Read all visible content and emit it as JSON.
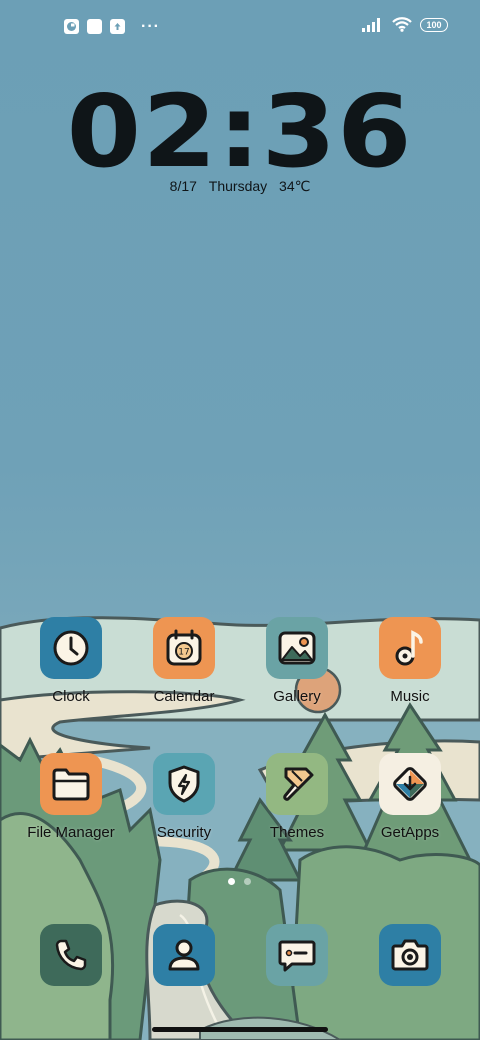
{
  "status_bar": {
    "left_icons": [
      "app-notification-icon",
      "square-notification-icon",
      "upload-notification-icon"
    ],
    "overflow": "···",
    "signal_icon": "signal-bars-icon",
    "wifi_icon": "wifi-icon",
    "battery": "100"
  },
  "clock_widget": {
    "time": "02:36",
    "date": "8/17",
    "weekday": "Thursday",
    "temperature": "34℃"
  },
  "apps": [
    {
      "label": "Clock",
      "icon": "clock-icon",
      "color": "#2e7fa5"
    },
    {
      "label": "Calendar",
      "icon": "calendar-icon",
      "color": "#ee9552"
    },
    {
      "label": "Gallery",
      "icon": "image-icon",
      "color": "#6aa3a5"
    },
    {
      "label": "Music",
      "icon": "music-note-icon",
      "color": "#ee9552"
    },
    {
      "label": "File Manager",
      "icon": "folder-icon",
      "color": "#ee9552"
    },
    {
      "label": "Security",
      "icon": "shield-bolt-icon",
      "color": "#5aa5b3"
    },
    {
      "label": "Themes",
      "icon": "paint-brush-icon",
      "color": "#93b882"
    },
    {
      "label": "GetApps",
      "icon": "getapps-icon",
      "color": "#f5efe2"
    }
  ],
  "dock": [
    {
      "name": "phone",
      "icon": "phone-icon",
      "color": "#3e6a5a"
    },
    {
      "name": "contacts",
      "icon": "person-icon",
      "color": "#2e7fa5"
    },
    {
      "name": "messages",
      "icon": "message-icon",
      "color": "#6aa3a5"
    },
    {
      "name": "camera",
      "icon": "camera-icon",
      "color": "#2e7fa5"
    }
  ],
  "calendar_day": "17",
  "page_indicator": {
    "pages": 2,
    "current": 1
  }
}
